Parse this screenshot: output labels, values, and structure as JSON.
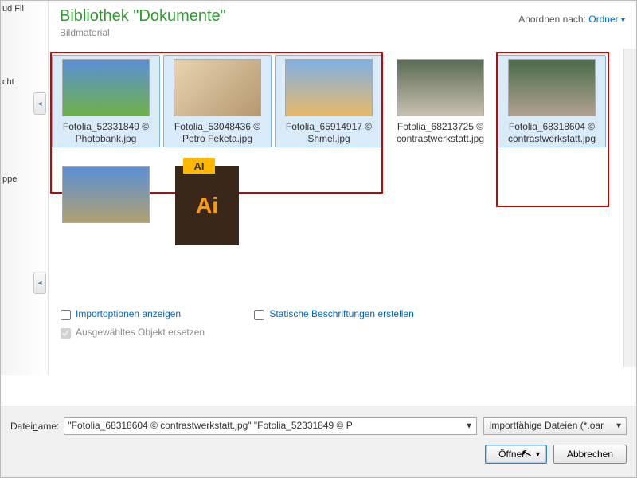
{
  "header": {
    "title": "Bibliothek \"Dokumente\"",
    "subtitle": "Bildmaterial"
  },
  "arrange": {
    "label": "Anordnen nach:",
    "value": "Ordner",
    "caret": "▾"
  },
  "sidebar": {
    "items": [
      "ud Fil",
      "cht",
      "",
      "ppe"
    ]
  },
  "thumbs": [
    {
      "label": "Fotolia_52331849 © Photobank.jpg",
      "selected": true,
      "cls": "building"
    },
    {
      "label": "Fotolia_53048436 © Petro Feketa.jpg",
      "selected": true,
      "cls": "kids1"
    },
    {
      "label": "Fotolia_65914917 © Shmel.jpg",
      "selected": true,
      "cls": "kids2"
    },
    {
      "label": "Fotolia_68213725 © contrastwerkstatt.jpg",
      "selected": false,
      "cls": "teacher"
    },
    {
      "label": "Fotolia_68318604 © contrastwerkstatt.jpg",
      "selected": true,
      "cls": "class"
    }
  ],
  "thumbs_row2": [
    {
      "label": "",
      "selected": false,
      "cls": "sport"
    },
    {
      "label": "",
      "selected": false,
      "cls": "ai",
      "ai_text": "Ai"
    }
  ],
  "options": {
    "col1": [
      {
        "label": "Importoptionen anzeigen",
        "checked": false,
        "enabled": true
      },
      {
        "label": "Ausgewähltes Objekt ersetzen",
        "checked": true,
        "enabled": false
      }
    ],
    "col2": [
      {
        "label": "Statische Beschriftungen erstellen",
        "checked": false,
        "enabled": true
      }
    ]
  },
  "filename": {
    "label_pre": "Datei",
    "label_ul": "n",
    "label_post": "ame:",
    "value": "\"Fotolia_68318604 © contrastwerkstatt.jpg\" \"Fotolia_52331849 © P"
  },
  "filetype": {
    "value": "Importfähige Dateien (*.oar"
  },
  "buttons": {
    "open": "Öffnen",
    "cancel": "Abbrechen"
  }
}
